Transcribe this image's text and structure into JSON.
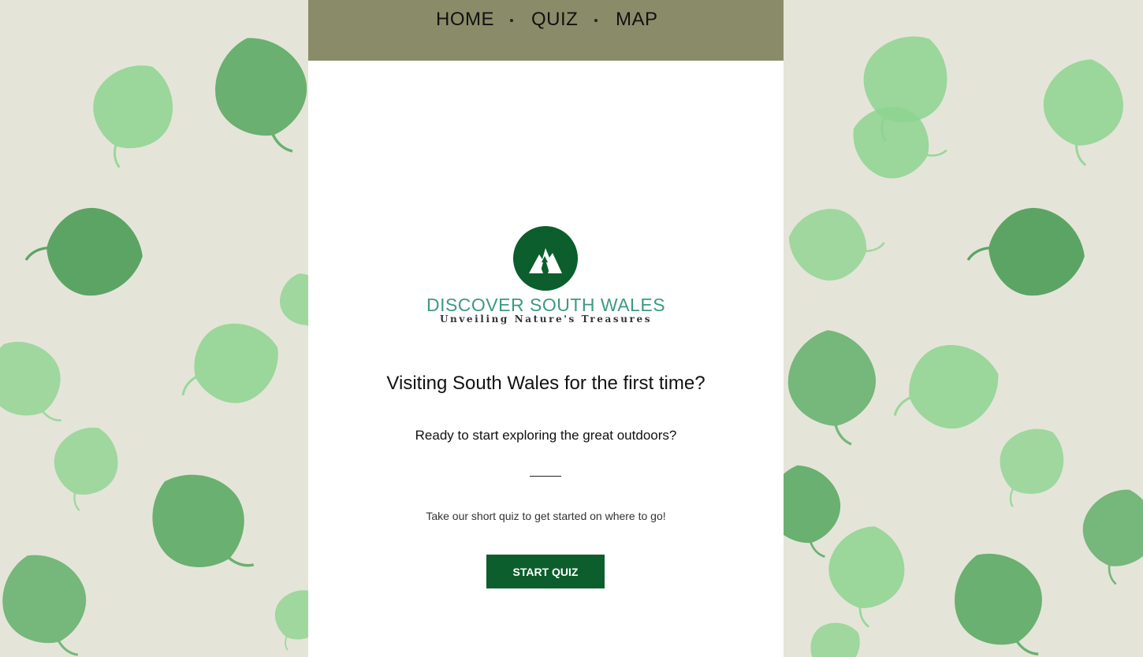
{
  "nav": {
    "items": [
      {
        "label": "HOME"
      },
      {
        "label": "QUIZ"
      },
      {
        "label": "MAP"
      }
    ]
  },
  "logo": {
    "title": "DISCOVER SOUTH WALES",
    "subtitle": "Unveiling Nature's Treasures",
    "icon": "mountain-trees-icon"
  },
  "hero": {
    "headline": "Visiting South Wales for the first time?",
    "subheading": "Ready to start exploring the great outdoors?",
    "lead": "Take our short quiz to get started on where to go!",
    "cta_label": "START QUIZ"
  },
  "colors": {
    "background": "#e4e5d8",
    "nav_bar": "#8a8c69",
    "brand_green": "#0c5e2c",
    "logo_text": "#3c9a80",
    "leaf_light": "#8fd491",
    "leaf_dark": "#4e9e58"
  }
}
